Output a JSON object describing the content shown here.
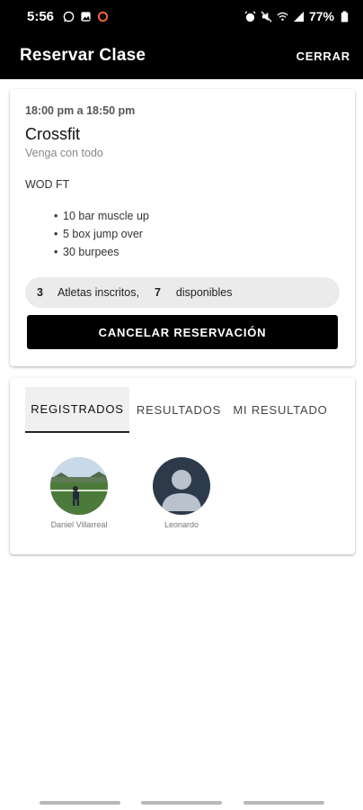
{
  "status_bar": {
    "time": "5:56",
    "battery": "77%",
    "left_icons": [
      "whatsapp-icon",
      "gallery-icon",
      "circle-icon"
    ],
    "right_icons": [
      "alarm-icon",
      "mute-icon",
      "wifi-icon",
      "signal-icon",
      "battery-icon"
    ]
  },
  "app_bar": {
    "title": "Reservar Clase",
    "close_label": "CERRAR"
  },
  "class_card": {
    "time_range": "18:00 pm a 18:50 pm",
    "name": "Crossfit",
    "subtitle": "Venga con todo",
    "wod_title": "WOD FT",
    "wod_items": [
      "10 bar muscle up",
      "5 box jump over",
      "30 burpees"
    ],
    "athletes": {
      "enrolled_count": "3",
      "enrolled_label": "Atletas inscritos,",
      "available_count": "7",
      "available_label": "disponibles"
    },
    "cancel_label": "CANCELAR RESERVACIÓN"
  },
  "tabs_card": {
    "tabs": [
      "REGISTRADOS",
      "RESULTADOS",
      "MI RESULTADO"
    ],
    "active_tab": "REGISTRADOS",
    "participants": [
      {
        "name": "Daniel Villarreal",
        "avatar": "photo"
      },
      {
        "name": "Leonardo",
        "avatar": "default-user-icon"
      }
    ]
  },
  "colors": {
    "app_bar": "#000000",
    "primary_button": "#000000",
    "pill_bg": "#ebebeb",
    "active_tab_bg": "#f0f0f0",
    "default_avatar_bg": "#2d3a4a",
    "default_avatar_fg": "#b9c2cd"
  }
}
